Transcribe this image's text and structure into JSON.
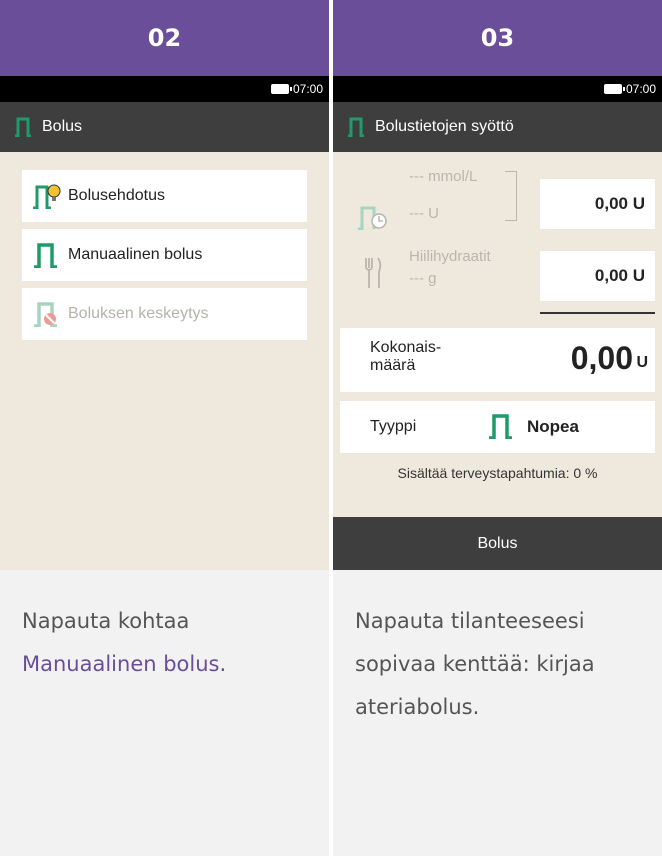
{
  "left": {
    "step": "02",
    "time": "07:00",
    "title": "Bolus",
    "menu": [
      {
        "label": "Bolusehdotus",
        "icon": "bolus-advice-icon"
      },
      {
        "label": "Manuaalinen bolus",
        "icon": "bolus-icon"
      },
      {
        "label": "Boluksen keskeytys",
        "icon": "bolus-cancel-icon"
      }
    ],
    "caption_before": "Napauta kohtaa",
    "caption_link": "Manuaalinen bolus",
    "caption_after": "."
  },
  "right": {
    "step": "03",
    "time": "07:00",
    "title": "Bolustietojen syöttö",
    "bg_value": "--- mmol/L",
    "advice_value": "--- U",
    "advice_box": "0,00 U",
    "carb_label": "Hiilihydraatit",
    "carb_value": "--- g",
    "carb_box": "0,00 U",
    "total_label": "Kokonais-\nmäärä",
    "total_value": "0,00",
    "total_unit": "U",
    "type_label": "Tyyppi",
    "type_value": "Nopea",
    "health_events": "Sisältää terveystapahtumia: 0 %",
    "button": "Bolus",
    "caption": "Napauta tilanteeseesi sopivaa kenttää: kirjaa ateriabolus."
  },
  "colors": {
    "accent": "#6a4e9a",
    "bolus_icon": "#1f9a6a",
    "screen_bg": "#efe9dd",
    "bar_dark": "#3e3e3e"
  }
}
